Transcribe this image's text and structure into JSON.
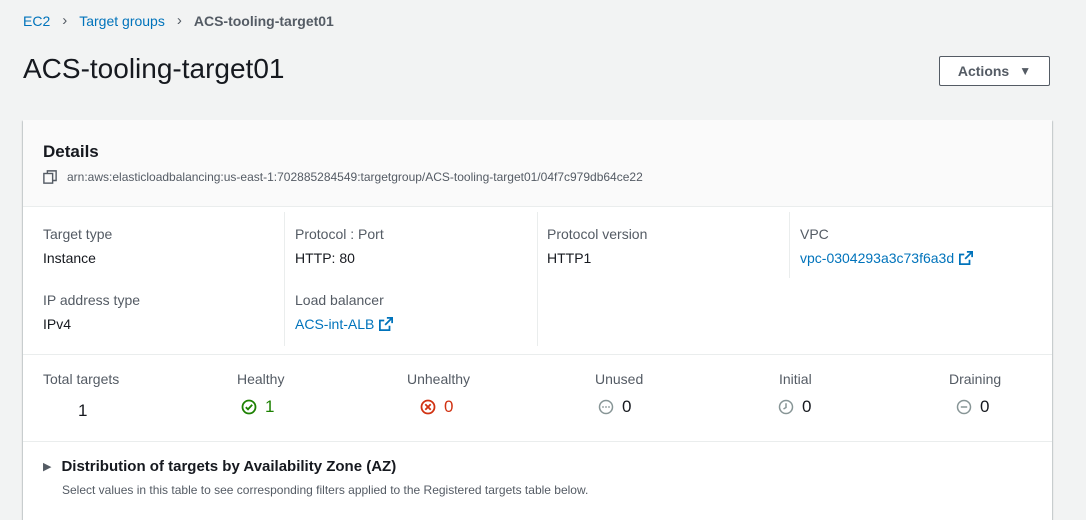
{
  "breadcrumb": {
    "items": [
      "EC2",
      "Target groups"
    ],
    "current": "ACS-tooling-target01"
  },
  "page": {
    "title": "ACS-tooling-target01",
    "actions_label": "Actions"
  },
  "details": {
    "title": "Details",
    "arn": "arn:aws:elasticloadbalancing:us-east-1:702885284549:targetgroup/ACS-tooling-target01/04f7c979db64ce22"
  },
  "attributes": {
    "target_type": {
      "label": "Target type",
      "value": "Instance"
    },
    "protocol_port": {
      "label": "Protocol : Port",
      "value": "HTTP: 80"
    },
    "protocol_version": {
      "label": "Protocol version",
      "value": "HTTP1"
    },
    "vpc": {
      "label": "VPC",
      "value": "vpc-0304293a3c73f6a3d"
    },
    "ip_address_type": {
      "label": "IP address type",
      "value": "IPv4"
    },
    "load_balancer": {
      "label": "Load balancer",
      "value": "ACS-int-ALB"
    }
  },
  "stats": {
    "total": {
      "label": "Total targets",
      "value": "1"
    },
    "healthy": {
      "label": "Healthy",
      "value": "1",
      "icon": "check-circle-icon",
      "color": "#1d8102"
    },
    "unhealthy": {
      "label": "Unhealthy",
      "value": "0",
      "icon": "x-circle-icon",
      "color": "#d13212"
    },
    "unused": {
      "label": "Unused",
      "value": "0",
      "icon": "ellipsis-circle-icon",
      "color": "#879596"
    },
    "initial": {
      "label": "Initial",
      "value": "0",
      "icon": "clock-icon",
      "color": "#879596"
    },
    "draining": {
      "label": "Draining",
      "value": "0",
      "icon": "minus-circle-icon",
      "color": "#879596"
    }
  },
  "az": {
    "title": "Distribution of targets by Availability Zone (AZ)",
    "description": "Select values in this table to see corresponding filters applied to the Registered targets table below."
  }
}
